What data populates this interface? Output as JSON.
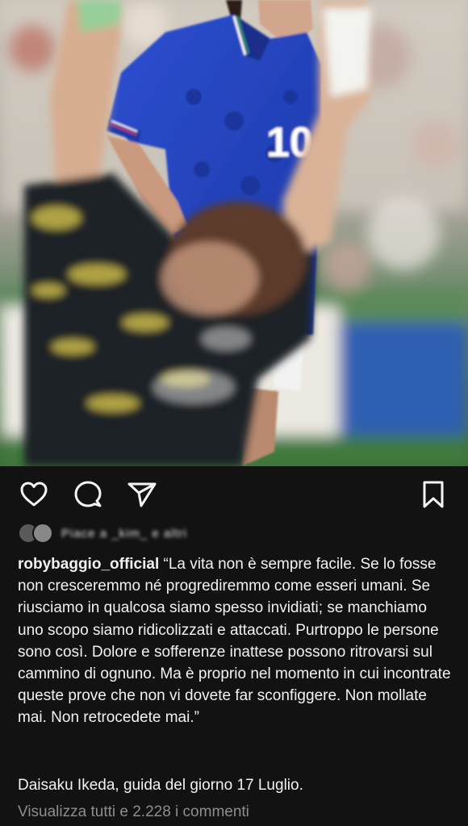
{
  "post": {
    "photo_description_icon": "photo",
    "username": "robybaggio_official",
    "caption": " “La vita non è sempre facile. Se lo fosse non cresceremmo né progrediremmo come esseri umani. Se riusciamo in qualcosa siamo spesso invidiati; se manchiamo uno scopo siamo ridicolizzati e attaccati. Purtroppo le persone sono così. Dolore e sofferenze inattese possono ritrovarsi sul cammino di ognuno. Ma è proprio nel momento in cui incontrate queste prove che non vi dovete far sconfiggere. Non mollate mai. Non retrocedete mai.”",
    "attribution": "Daisaku Ikeda, guida del giorno 17 Luglio.",
    "view_comments": "Visualizza tutti e 2.228 i commenti",
    "jersey_number": "10",
    "likes_obscured": "Piace a _kim_ e altri"
  },
  "actions": {
    "like_icon": "heart-icon",
    "comment_icon": "comment-icon",
    "share_icon": "send-icon",
    "save_icon": "bookmark-icon"
  },
  "colors": {
    "background": "#121212",
    "text": "#f2f2f2",
    "muted": "#8e8e8e"
  }
}
